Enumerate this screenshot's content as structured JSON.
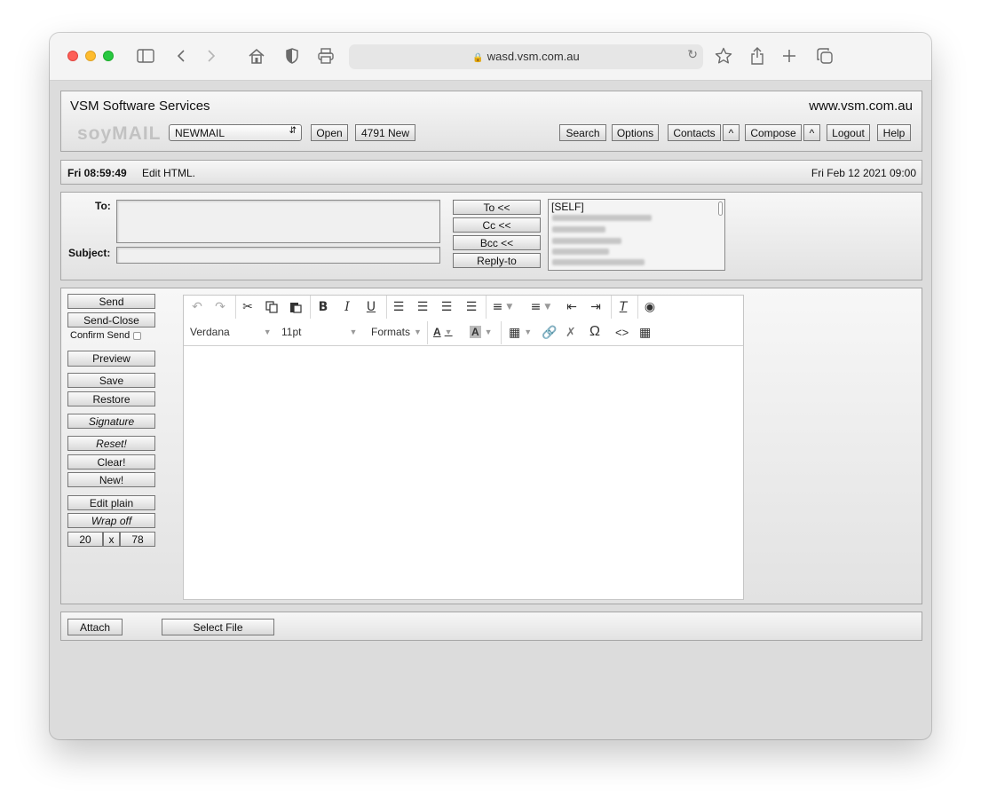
{
  "browser": {
    "url": "wasd.vsm.com.au"
  },
  "header": {
    "company": "VSM Software Services",
    "website": "www.vsm.com.au",
    "logo": "soyMAIL",
    "folder_select": "NEWMAIL",
    "open_label": "Open",
    "new_count": "4791 New",
    "search_label": "Search",
    "options_label": "Options",
    "contacts_label": "Contacts",
    "caret_label": "^",
    "compose_label": "Compose",
    "logout_label": "Logout",
    "help_label": "Help"
  },
  "status": {
    "time": "Fri 08:59:49",
    "message": "Edit HTML.",
    "date": "Fri Feb 12 2021 09:00"
  },
  "address": {
    "to_label": "To:",
    "subject_label": "Subject:",
    "to_btn": "To <<",
    "cc_btn": "Cc <<",
    "bcc_btn": "Bcc <<",
    "replyto_btn": "Reply-to",
    "first_contact": "[SELF]"
  },
  "side": {
    "send": "Send",
    "send_close": "Send-Close",
    "confirm_send": "Confirm Send",
    "preview": "Preview",
    "save": "Save",
    "restore": "Restore",
    "signature": "Signature",
    "reset": "Reset!",
    "clear": "Clear!",
    "new": "New!",
    "edit_plain": "Edit plain",
    "wrap_off": "Wrap off",
    "rows": "20",
    "x": "x",
    "cols": "78"
  },
  "editor": {
    "font": "Verdana",
    "size": "11pt",
    "formats": "Formats"
  },
  "attach": {
    "attach_label": "Attach",
    "select_file": "Select File"
  },
  "icons": [
    "sidebar-icon",
    "back-icon",
    "forward-icon",
    "home-icon",
    "shield-icon",
    "print-icon",
    "lock-icon",
    "reload-icon",
    "bookmark-star-icon",
    "share-icon",
    "new-tab-icon",
    "tabs-icon"
  ]
}
